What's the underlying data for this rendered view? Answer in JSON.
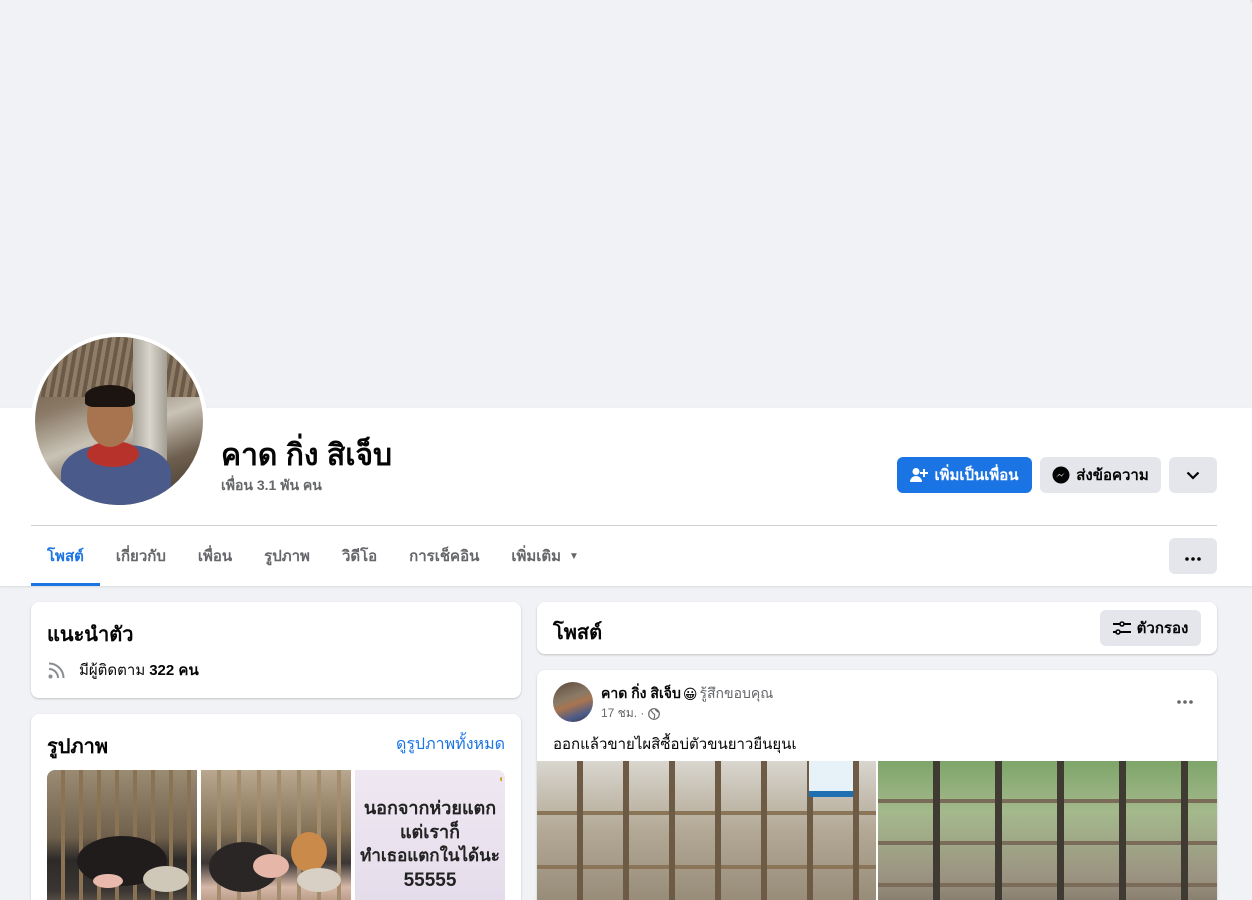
{
  "profile": {
    "name": "คาด กิ่ง สิเจ็บ",
    "friends": "เพื่อน 3.1 พัน คน"
  },
  "actions": {
    "add_friend": "เพิ่มเป็นเพื่อน",
    "message": "ส่งข้อความ"
  },
  "tabs": [
    {
      "label": "โพสต์"
    },
    {
      "label": "เกี่ยวกับ"
    },
    {
      "label": "เพื่อน"
    },
    {
      "label": "รูปภาพ"
    },
    {
      "label": "วิดีโอ"
    },
    {
      "label": "การเช็คอิน"
    },
    {
      "label": "เพิ่มเติม"
    }
  ],
  "intro": {
    "title": "แนะนำตัว",
    "followers_prefix": "มีผู้ติดตาม",
    "followers_count": "322 คน"
  },
  "photos": {
    "title": "รูปภาพ",
    "see_all": "ดูรูปภาพทั้งหมด",
    "meme_lines": [
      "นอกจากห่วยแตก",
      "แต่เราก็",
      "ทำเธอแตกในได้นะ",
      "55555"
    ]
  },
  "posts": {
    "title": "โพสต์",
    "filter_label": "ตัวกรอง"
  },
  "post": {
    "author": "คาด กิ่ง สิเจ็บ",
    "emoji": "😀",
    "feeling": "รู้สึกขอบคุณ",
    "time": "17 ชม. ·",
    "text": "ออกแล้วขายไผสิซื้อบ่ตัวขนยาวยืนยุนเ"
  },
  "colors": {
    "accent": "#1b74e4",
    "secondary_button": "#e4e6eb",
    "page_bg": "#f0f2f5",
    "muted_text": "#65676b"
  }
}
